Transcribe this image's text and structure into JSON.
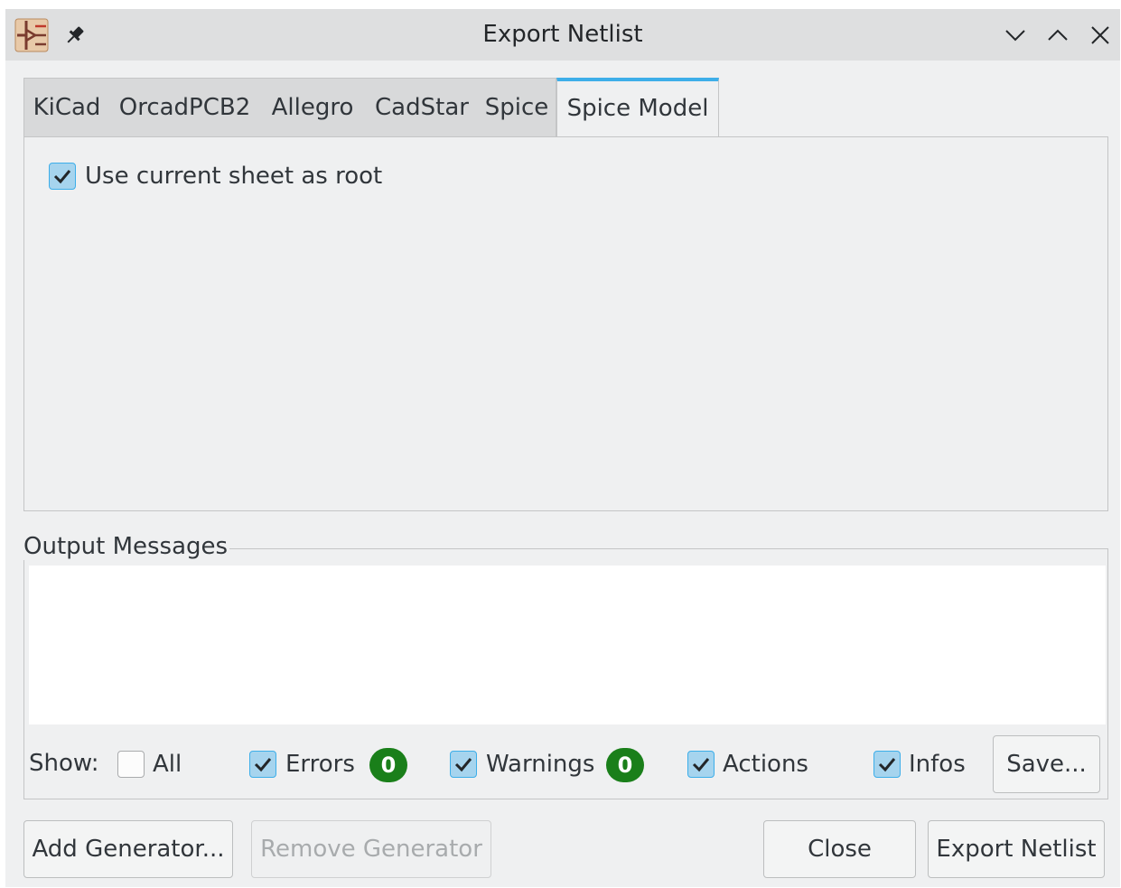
{
  "window": {
    "title": "Export Netlist"
  },
  "icons": {
    "app": "kicad-schematic-icon",
    "pin": "pin-icon",
    "minimize": "chevron-down-icon",
    "maximize": "chevron-up-icon",
    "close": "close-icon"
  },
  "tabs": [
    {
      "label": "KiCad",
      "active": false
    },
    {
      "label": "OrcadPCB2",
      "active": false
    },
    {
      "label": "Allegro",
      "active": false
    },
    {
      "label": "CadStar",
      "active": false
    },
    {
      "label": "Spice",
      "active": false
    },
    {
      "label": "Spice Model",
      "active": true
    }
  ],
  "spice_model": {
    "use_current_sheet_label": "Use current sheet as root",
    "use_current_sheet_checked": true
  },
  "output": {
    "group_title": "Output Messages",
    "show_label": "Show:",
    "filters": {
      "all": {
        "label": "All",
        "checked": false
      },
      "errors": {
        "label": "Errors",
        "checked": true,
        "count": "0"
      },
      "warnings": {
        "label": "Warnings",
        "checked": true,
        "count": "0"
      },
      "actions": {
        "label": "Actions",
        "checked": true
      },
      "infos": {
        "label": "Infos",
        "checked": true
      }
    },
    "save_label": "Save..."
  },
  "buttons": {
    "add_generator": "Add Generator...",
    "remove_generator": "Remove Generator",
    "close": "Close",
    "export_netlist": "Export Netlist"
  },
  "colors": {
    "accent": "#3daee9",
    "badge": "#1a7f1a",
    "window_bg": "#eff0f1"
  }
}
